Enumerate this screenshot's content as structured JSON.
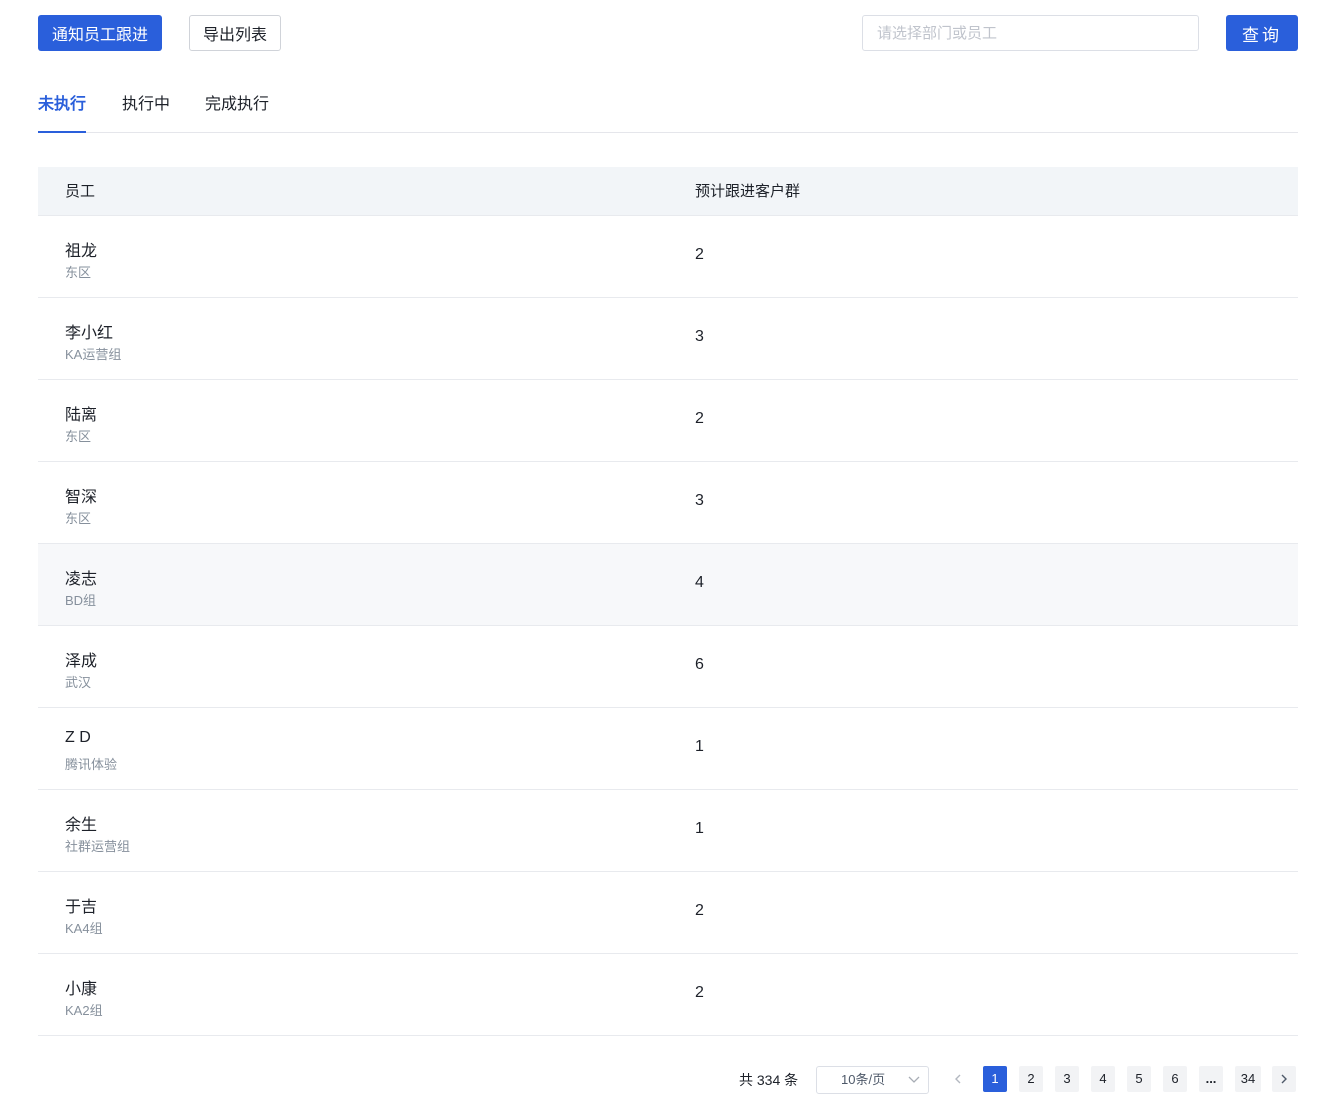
{
  "toolbar": {
    "notify_label": "通知员工跟进",
    "export_label": "导出列表",
    "search_placeholder": "请选择部门或员工",
    "query_label": "查询"
  },
  "tabs": [
    {
      "label": "未执行",
      "active": true
    },
    {
      "label": "执行中",
      "active": false
    },
    {
      "label": "完成执行",
      "active": false
    }
  ],
  "table": {
    "columns": [
      "员工",
      "预计跟进客户群"
    ],
    "rows": [
      {
        "name": "祖龙",
        "dept": "东区",
        "count": "2"
      },
      {
        "name": "李小红",
        "dept": "KA运营组",
        "count": "3"
      },
      {
        "name": "陆离",
        "dept": "东区",
        "count": "2"
      },
      {
        "name": "智深",
        "dept": "东区",
        "count": "3"
      },
      {
        "name": "凌志",
        "dept": "BD组",
        "count": "4"
      },
      {
        "name": "泽成",
        "dept": "武汉",
        "count": "6"
      },
      {
        "name": "Z D",
        "dept": "腾讯体验",
        "count": "1"
      },
      {
        "name": "余生",
        "dept": "社群运营组",
        "count": "1"
      },
      {
        "name": "于吉",
        "dept": "KA4组",
        "count": "2"
      },
      {
        "name": "小康",
        "dept": "KA2组",
        "count": "2"
      }
    ]
  },
  "pagination": {
    "total_text": "共 334 条",
    "page_size": "10条/页",
    "pages": [
      "1",
      "2",
      "3",
      "4",
      "5",
      "6",
      "...",
      "34"
    ],
    "current_page": "1"
  },
  "colors": {
    "primary": "#2a5fdb",
    "header_bg": "#f2f5f8",
    "hover_row_bg": "#f7f8fa"
  }
}
